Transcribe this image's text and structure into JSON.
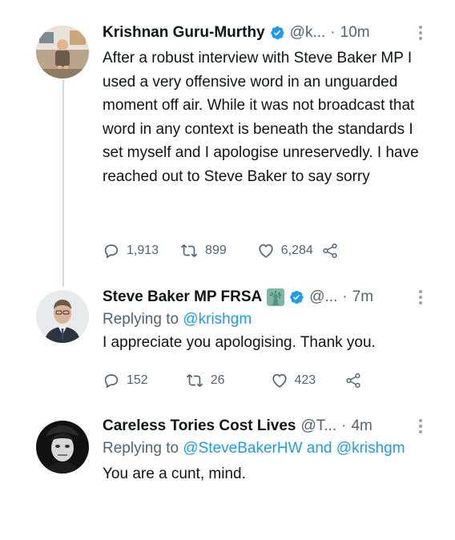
{
  "tweets": [
    {
      "name": "Krishnan Guru-Murthy",
      "handle": "@k...",
      "dot": "·",
      "time": "10m",
      "text": "After a robust interview with Steve Baker MP I used a very offensive word in an unguarded moment off air.  While it was not broadcast that word in any context is beneath the standards I set myself and I apologise unreservedly. I have reached out to Steve Baker to say sorry",
      "replies": "1,913",
      "retweets": "899",
      "likes": "6,284"
    },
    {
      "name": "Steve Baker MP FRSA",
      "handle": "@...",
      "dot": "·",
      "time": "7m",
      "reply_prefix": "Replying to",
      "reply_to": "@krishgm",
      "text": "I appreciate you apologising. Thank you.",
      "replies": "152",
      "retweets": "26",
      "likes": "423"
    },
    {
      "name": "Careless Tories Cost Lives",
      "handle": "@T...",
      "dot": "·",
      "time": "4m",
      "reply_prefix": "Replying to",
      "reply_to_1": "@SteveBakerHW",
      "reply_and": "and",
      "reply_to_2": "@krishgm",
      "text": "You are a cunt, mind."
    }
  ],
  "colors": {
    "text": "#0f1419",
    "secondary": "#536471",
    "link": "#1d9bf0",
    "verified": "#1d9bf0",
    "thread_line": "#cfd9de"
  },
  "icons": [
    "reply-icon",
    "retweet-icon",
    "like-icon",
    "share-icon",
    "verified-icon",
    "more-icon",
    "statue-of-liberty-icon"
  ]
}
